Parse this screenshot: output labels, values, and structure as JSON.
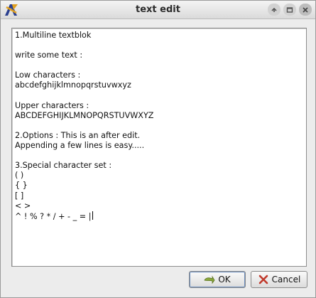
{
  "window": {
    "title": "text edit"
  },
  "editor": {
    "lines": [
      "1.Multiline textblok",
      "",
      "write some text :",
      "",
      "Low characters :",
      "abcdefghijklmnopqrstuvwxyz",
      "",
      "Upper characters :",
      "ABCDEFGHIJKLMNOPQRSTUVWXYZ",
      "",
      "2.Options : This is an after edit.",
      "Appending a few lines is easy.....",
      "",
      "3.Special character set :",
      "( )",
      "{ }",
      "[ ]",
      "< >",
      "^ ! % ? * / + - _ = |"
    ]
  },
  "buttons": {
    "ok_label": "OK",
    "cancel_label": "Cancel"
  },
  "icons": {
    "app": "app-logo-icon",
    "maximize": "chevron-up-icon",
    "restore": "square-icon",
    "close": "close-icon",
    "ok": "ok-icon",
    "cancel": "cancel-x-icon"
  },
  "colors": {
    "ok_icon": "#6b8a2e",
    "cancel_icon": "#c0392b",
    "app_icon_primary": "#2a3f8f",
    "app_icon_accent": "#e0a020"
  }
}
